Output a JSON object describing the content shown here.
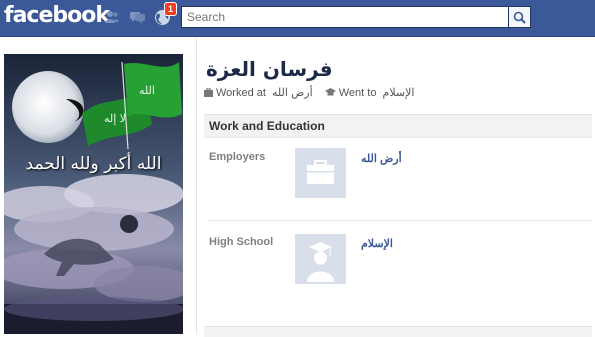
{
  "app": {
    "logo": "facebook"
  },
  "header": {
    "notification_count": "1",
    "search_placeholder": "Search"
  },
  "profile": {
    "name": "فرسان العزة",
    "worked_at_label": "Worked at",
    "worked_at_value": "أرض الله",
    "went_to_label": "Went to",
    "went_to_value": "الإسلام",
    "cover_text": "الله أكبر ولله الحمد"
  },
  "work_education": {
    "title": "Work and Education",
    "employers_label": "Employers",
    "employer_name": "أرض الله",
    "high_school_label": "High School",
    "high_school_name": "الإسلام"
  },
  "icons": {
    "friends": "friends-icon",
    "messages": "messages-icon",
    "notifications": "globe-icon",
    "search": "search-icon",
    "work": "briefcase-icon",
    "school": "graduation-icon"
  },
  "colors": {
    "brand": "#3b5998",
    "badge": "#f03d25",
    "link": "#3b5998",
    "section_bg": "#f2f2f2"
  }
}
